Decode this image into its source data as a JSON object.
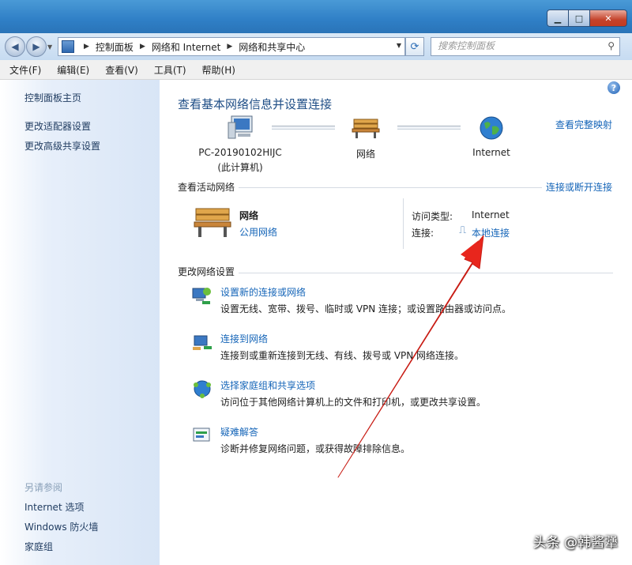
{
  "window": {
    "minimize": "▁",
    "maximize": "□",
    "close": "✕"
  },
  "navbar": {
    "back": "◀",
    "forward": "▶",
    "breadcrumb": [
      "控制面板",
      "网络和 Internet",
      "网络和共享中心"
    ],
    "search_placeholder": "搜索控制面板"
  },
  "menu": [
    "文件(F)",
    "编辑(E)",
    "查看(V)",
    "工具(T)",
    "帮助(H)"
  ],
  "sidebar": {
    "home": "控制面板主页",
    "links": [
      "更改适配器设置",
      "更改高级共享设置"
    ],
    "see_also_header": "另请参阅",
    "see_also": [
      "Internet 选项",
      "Windows 防火墙",
      "家庭组"
    ]
  },
  "main": {
    "help": "?",
    "title": "查看基本网络信息并设置连接",
    "view_full_map": "查看完整映射",
    "map": {
      "computer_name": "PC-20190102HIJC",
      "computer_sub": "(此计算机)",
      "network": "网络",
      "internet": "Internet"
    },
    "active": {
      "header": "查看活动网络",
      "connect_disconnect": "连接或断开连接",
      "network_name": "网络",
      "network_type": "公用网络",
      "access_label": "访问类型:",
      "access_value": "Internet",
      "conn_label": "连接:",
      "conn_value": "本地连接"
    },
    "settings": {
      "header": "更改网络设置",
      "tasks": [
        {
          "title": "设置新的连接或网络",
          "desc": "设置无线、宽带、拨号、临时或 VPN 连接；或设置路由器或访问点。"
        },
        {
          "title": "连接到网络",
          "desc": "连接到或重新连接到无线、有线、拨号或 VPN 网络连接。"
        },
        {
          "title": "选择家庭组和共享选项",
          "desc": "访问位于其他网络计算机上的文件和打印机，或更改共享设置。"
        },
        {
          "title": "疑难解答",
          "desc": "诊断并修复网络问题，或获得故障排除信息。"
        }
      ]
    }
  },
  "watermark": "头条 @韩酱犟",
  "colors": {
    "link": "#1565b8",
    "title": "#1f4e86",
    "arrow": "#e8261d"
  }
}
